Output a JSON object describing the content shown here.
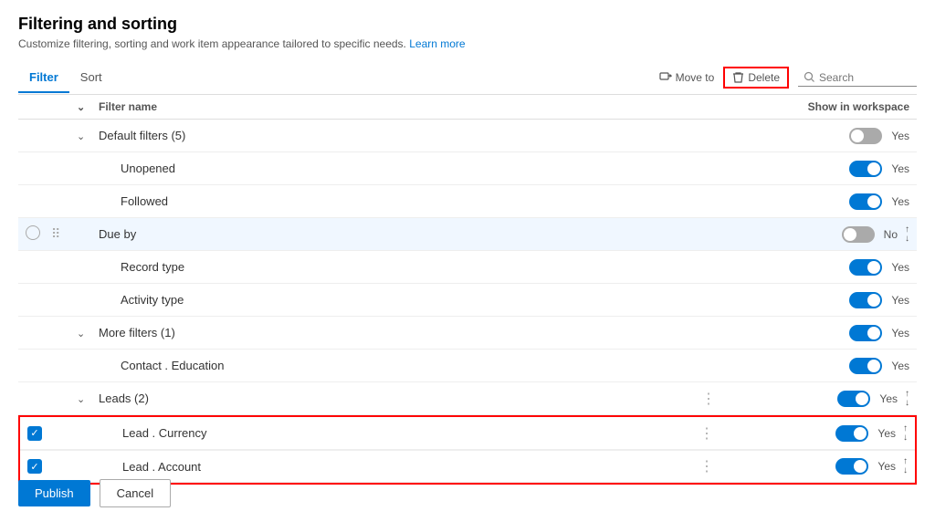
{
  "page": {
    "title": "Filtering and sorting",
    "subtitle": "Customize filtering, sorting and work item appearance tailored to specific needs.",
    "learn_more": "Learn more"
  },
  "tabs": [
    {
      "id": "filter",
      "label": "Filter",
      "active": true
    },
    {
      "id": "sort",
      "label": "Sort",
      "active": false
    }
  ],
  "toolbar": {
    "move_to_label": "Move to",
    "delete_label": "Delete",
    "search_placeholder": "Search"
  },
  "table": {
    "col_name": "Filter name",
    "col_show": "Show in workspace",
    "rows": [
      {
        "id": "default-filters",
        "indent": 1,
        "chevron": true,
        "label": "Default filters (5)",
        "toggle": "off",
        "toggle_label": "Yes",
        "type": "group"
      },
      {
        "id": "unopened",
        "indent": 2,
        "label": "Unopened",
        "toggle": "on",
        "toggle_label": "Yes",
        "type": "child"
      },
      {
        "id": "followed",
        "indent": 2,
        "label": "Followed",
        "toggle": "on",
        "toggle_label": "Yes",
        "type": "child"
      },
      {
        "id": "due-by",
        "indent": 0,
        "label": "Due by",
        "toggle": "off",
        "toggle_label": "No",
        "type": "item",
        "circle": true,
        "drag": true,
        "arrows": true,
        "highlighted": true
      },
      {
        "id": "record-type",
        "indent": 2,
        "label": "Record type",
        "toggle": "on",
        "toggle_label": "Yes",
        "type": "child"
      },
      {
        "id": "activity-type",
        "indent": 2,
        "label": "Activity type",
        "toggle": "on",
        "toggle_label": "Yes",
        "type": "child"
      },
      {
        "id": "more-filters",
        "indent": 1,
        "chevron": true,
        "label": "More filters (1)",
        "toggle": "on",
        "toggle_label": "Yes",
        "type": "group"
      },
      {
        "id": "contact-education",
        "indent": 2,
        "label": "Contact . Education",
        "toggle": "on",
        "toggle_label": "Yes",
        "type": "child"
      },
      {
        "id": "leads",
        "indent": 1,
        "chevron": true,
        "label": "Leads (2)",
        "dots": true,
        "toggle": "on",
        "toggle_label": "Yes",
        "type": "group",
        "arrows": true
      },
      {
        "id": "lead-currency",
        "indent": 2,
        "label": "Lead . Currency",
        "dots": true,
        "toggle": "on",
        "toggle_label": "Yes",
        "type": "selected",
        "checked": true,
        "arrows": true
      },
      {
        "id": "lead-account",
        "indent": 2,
        "label": "Lead . Account",
        "dots": true,
        "toggle": "on",
        "toggle_label": "Yes",
        "type": "selected",
        "checked": true,
        "arrows": true
      }
    ]
  },
  "buttons": {
    "publish": "Publish",
    "cancel": "Cancel"
  }
}
